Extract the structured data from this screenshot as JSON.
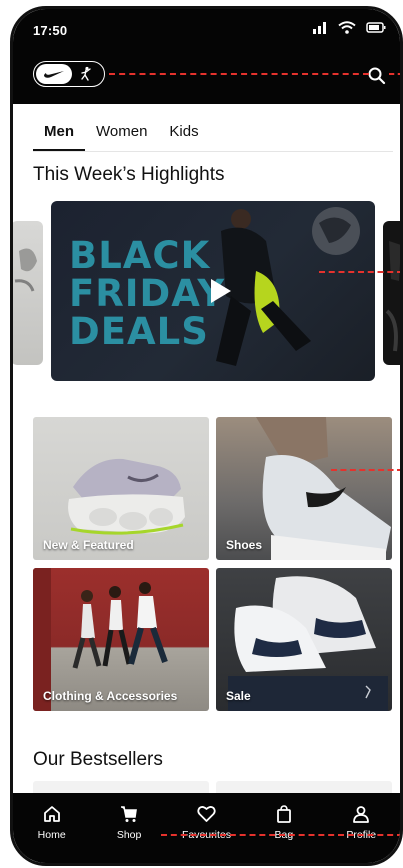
{
  "status_bar": {
    "time": "17:50"
  },
  "header": {
    "brand_toggle": [
      "nike-swoosh-icon",
      "jordan-jumpman-icon"
    ],
    "search_icon": "search-icon"
  },
  "tabs": [
    {
      "label": "Men",
      "active": true
    },
    {
      "label": "Women",
      "active": false
    },
    {
      "label": "Kids",
      "active": false
    }
  ],
  "highlights": {
    "title": "This Week’s Highlights",
    "hero_text": [
      "BLACK",
      "FRIDAY",
      "DEALS"
    ],
    "play_icon": "play-icon"
  },
  "categories": [
    {
      "label": "New & Featured"
    },
    {
      "label": "Shoes"
    },
    {
      "label": "Clothing & Accessories"
    },
    {
      "label": "Sale"
    }
  ],
  "bestsellers": {
    "title": "Our Bestsellers"
  },
  "bottom_nav": [
    {
      "label": "Home",
      "icon": "home-icon"
    },
    {
      "label": "Shop",
      "icon": "cart-icon"
    },
    {
      "label": "Favourites",
      "icon": "heart-icon"
    },
    {
      "label": "Bag",
      "icon": "bag-icon"
    },
    {
      "label": "Profile",
      "icon": "profile-icon"
    }
  ],
  "colors": {
    "accent_dashes": "#e5322d",
    "bar_bg": "#050505",
    "hero_text": "#2b8fa2"
  }
}
